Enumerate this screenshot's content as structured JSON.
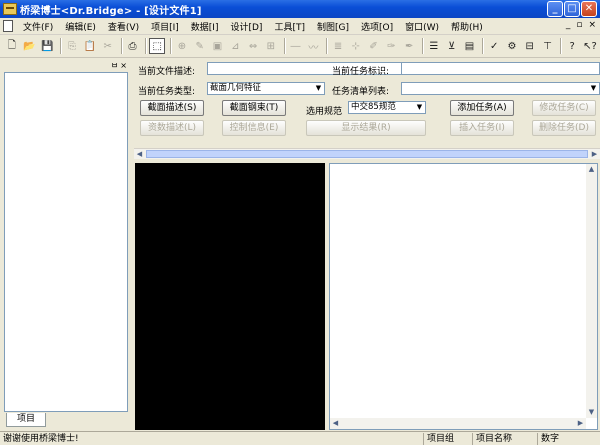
{
  "window": {
    "title": "桥梁博士<Dr.Bridge> - [设计文件1]",
    "minimize": "_",
    "maximize": "□",
    "close": "✕"
  },
  "menu": {
    "items": [
      "文件(F)",
      "编辑(E)",
      "查看(V)",
      "项目[I]",
      "数据[I]",
      "设计[D]",
      "工具[T]",
      "制图[G]",
      "选项[O]",
      "窗口(W)",
      "帮助(H)"
    ],
    "mdi": [
      "_",
      "▫",
      "×"
    ]
  },
  "left_panel": {
    "pin": "ㅂ",
    "close": "×",
    "tab_label": "项目"
  },
  "form": {
    "current_file_desc_label": "当前文件描述:",
    "current_file_desc_value": "",
    "current_task_id_label": "当前任务标识:",
    "current_task_id_value": "",
    "current_task_type_label": "当前任务类型:",
    "current_task_type_value": "截面几何特征",
    "task_list_label": "任务清单列表:",
    "task_list_value": "",
    "code_label": "选用规范",
    "code_value": "中交85规范"
  },
  "buttons": {
    "section_desc": "截面描述(S)",
    "section_steel": "截面钢束(T)",
    "add_task": "添加任务(A)",
    "modify_task": "修改任务(C)",
    "param_desc": "资数描述(L)",
    "control_info": "控制信息(E)",
    "show_results": "显示结果(R)",
    "insert_task": "插入任务(I)",
    "delete_task": "删除任务(D)"
  },
  "status": {
    "message": "谢谢使用桥梁博士!",
    "project_group": "项目组",
    "project_name": "项目名称",
    "mode": "数字"
  }
}
